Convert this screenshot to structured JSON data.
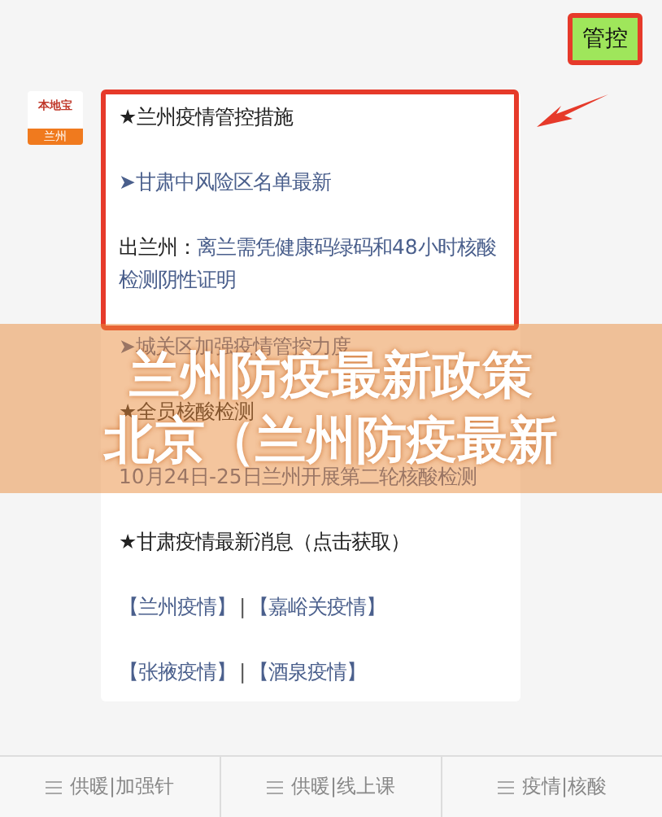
{
  "reply_bubble": {
    "text": "管控"
  },
  "avatar": {
    "brand": "本地宝",
    "city": "兰州"
  },
  "message": {
    "highlighted": [
      {
        "kind": "heading",
        "text": "★兰州疫情管控措施"
      },
      {
        "kind": "link",
        "text": "➤甘肃中风险区名单最新"
      },
      {
        "kind": "label_link",
        "label": "出兰州：",
        "text": "离兰需凭健康码绿码和48小时核酸检测阴性证明"
      }
    ],
    "rest": [
      {
        "kind": "link",
        "text": "➤城关区加强疫情管控力度"
      },
      {
        "kind": "heading",
        "text": "★全员核酸检测"
      },
      {
        "kind": "link",
        "text": "10月24日-25日兰州开展第二轮核酸检测"
      },
      {
        "kind": "heading",
        "text": "★甘肃疫情最新消息（点击获取）"
      },
      {
        "kind": "pair",
        "links": [
          "【兰州疫情】",
          "【嘉峪关疫情】"
        ],
        "separator": "|"
      },
      {
        "kind": "pair",
        "links": [
          "【张掖疫情】",
          "【酒泉疫情】"
        ],
        "separator": "|"
      }
    ]
  },
  "title_banner": {
    "lines": [
      "兰州防疫最新政策",
      "北京（兰州防疫最新"
    ]
  },
  "bottom_nav": [
    {
      "label": "供暖|加强针"
    },
    {
      "label": "供暖|线上课"
    },
    {
      "label": "疫情|核酸"
    }
  ]
}
